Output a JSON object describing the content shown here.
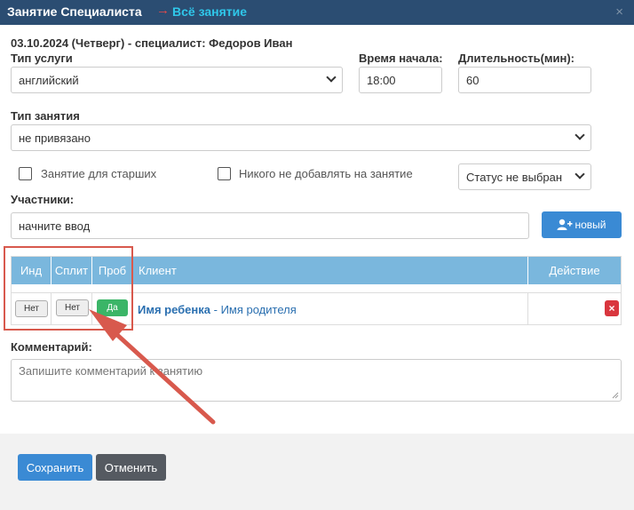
{
  "window": {
    "title": "Занятие Специалиста",
    "arrow": "→",
    "link": "Всё занятие",
    "close": "×"
  },
  "header": {
    "subtitle": "03.10.2024 (Четверг) - специалист: Федоров Иван"
  },
  "form": {
    "service_type_label": "Тип услуги",
    "service_type_value": "английский",
    "start_time_label": "Время начала:",
    "start_time_value": "18:00",
    "duration_label": "Длительность(мин):",
    "duration_value": "60",
    "lesson_type_label": "Тип занятия",
    "lesson_type_value": "не привязано",
    "checkbox_seniors_label": "Занятие для старших",
    "checkbox_no_add_label": "Никого не добавлять на занятие",
    "status_value": "Статус не выбран",
    "participants_label": "Участники:",
    "participants_placeholder": "начните ввод",
    "new_button_label": "новый",
    "comment_label": "Комментарий:",
    "comment_placeholder": "Запишите комментарий к занятию"
  },
  "table": {
    "columns": [
      "Инд",
      "Сплит",
      "Проб",
      "Клиент",
      "Действие"
    ],
    "row": {
      "ind": "Нет",
      "split": "Нет",
      "trial": "Да",
      "child_name": "Имя ребенка",
      "separator": " - ",
      "parent_name": "Имя родителя",
      "delete_icon": "×"
    }
  },
  "footer": {
    "save_label": "Сохранить",
    "cancel_label": "Отменить"
  },
  "colors": {
    "titlebar": "#2b4d72",
    "table_header": "#7ab7dd",
    "primary": "#3a8ad4",
    "success": "#3bb567",
    "danger": "#d9363e",
    "annotation": "#d8594d"
  },
  "icons": {
    "new_button": "add-user-icon",
    "select": "chevron-down-icon",
    "delete": "close-icon"
  }
}
